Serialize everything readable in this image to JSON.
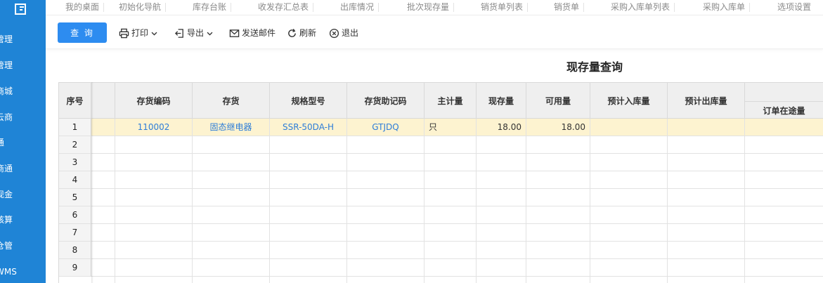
{
  "sidebar": {
    "items": [
      "管理",
      "管理",
      "商城",
      "云商",
      "通",
      "商通",
      "现金",
      "核算",
      "仓管",
      "WMS"
    ]
  },
  "tabs": [
    "我的桌面",
    "初始化导航",
    "库存台账",
    "收发存汇总表",
    "出库情况",
    "批次现存量",
    "销货单列表",
    "销货单",
    "采购入库单列表",
    "采购入库单",
    "选项设置"
  ],
  "toolbar": {
    "query": "查 询",
    "print": "打印",
    "export": "导出",
    "send_mail": "发送邮件",
    "refresh": "刷新",
    "exit": "退出"
  },
  "report": {
    "title": "现存量查询"
  },
  "table": {
    "headers": {
      "seq": "序号",
      "code": "存货编码",
      "name": "存货",
      "spec": "规格型号",
      "mnemonic": "存货助记码",
      "unit": "主计量",
      "onhand": "现存量",
      "available": "可用量",
      "in_expected": "预计入库量",
      "out_expected": "预计出库量",
      "in_transit": "订单在途量"
    },
    "row_numbers": [
      "1",
      "2",
      "3",
      "4",
      "5",
      "6",
      "7",
      "8",
      "9"
    ],
    "rows": [
      {
        "code": "110002",
        "name": "固态继电器",
        "spec": "SSR-50DA-H",
        "mnemonic": "GTJDQ",
        "unit": "只",
        "onhand": "18.00",
        "available": "18.00",
        "in_expected": "",
        "out_expected": "",
        "in_transit": ""
      }
    ]
  },
  "colors": {
    "sidebar": "#1f84d6",
    "primary": "#2d8cf0",
    "link": "#2d7dd8",
    "selected_row": "#fdf3d0"
  }
}
